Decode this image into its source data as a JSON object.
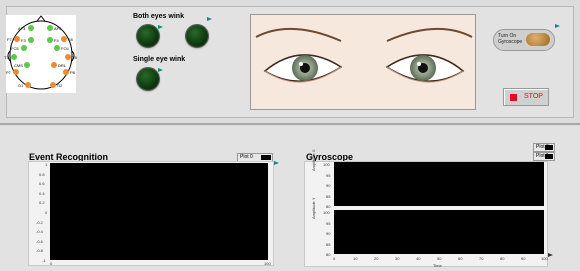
{
  "labels": {
    "both_eyes": "Both eyes wink",
    "single_eye": "Single eye wink"
  },
  "electrodes": [
    {
      "name": "AF3",
      "color": "green"
    },
    {
      "name": "AF4",
      "color": "green"
    },
    {
      "name": "F7",
      "color": "orange"
    },
    {
      "name": "F3",
      "color": "green"
    },
    {
      "name": "F4",
      "color": "green"
    },
    {
      "name": "F8",
      "color": "orange"
    },
    {
      "name": "FC5",
      "color": "green"
    },
    {
      "name": "FC6",
      "color": "green"
    },
    {
      "name": "T7",
      "color": "green"
    },
    {
      "name": "T8",
      "color": "orange"
    },
    {
      "name": "CMS",
      "color": "green"
    },
    {
      "name": "DRL",
      "color": "orange"
    },
    {
      "name": "P7",
      "color": "orange"
    },
    {
      "name": "P8",
      "color": "orange"
    },
    {
      "name": "O1",
      "color": "orange"
    },
    {
      "name": "O2",
      "color": "orange"
    }
  ],
  "gyro_button": {
    "line1": "Turn On",
    "line2": "Gyroscope"
  },
  "stop_button": {
    "label": "STOP"
  },
  "event": {
    "title": "Event Recognition",
    "legend": "Plot 0",
    "yticks": [
      "1",
      "0.8",
      "0.6",
      "0.4",
      "0.2",
      "0",
      "-0.2",
      "-0.4",
      "-0.6",
      "-0.8",
      "-1"
    ],
    "xticks": [
      "0",
      "100"
    ]
  },
  "gyro": {
    "title": "Gyroscope",
    "legend": [
      "Plot 0",
      "Plot 1"
    ],
    "top_ylabel": "Amplitude X",
    "bottom_ylabel": "Amplitude Y",
    "top_yticks": [
      "100",
      "95",
      "90",
      "85",
      "80"
    ],
    "bottom_yticks": [
      "100",
      "95",
      "90",
      "85",
      "80"
    ],
    "xticks": [
      "0",
      "10",
      "20",
      "30",
      "40",
      "50",
      "60",
      "70",
      "80",
      "90",
      "100"
    ],
    "xlabel": "Time"
  },
  "colors": {
    "green": "#5cc84a",
    "orange": "#f08a30",
    "teal": "#0a8a8a"
  }
}
